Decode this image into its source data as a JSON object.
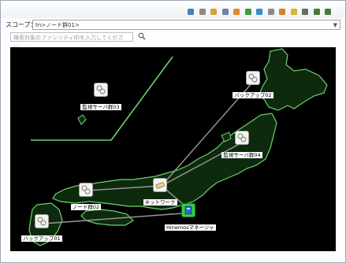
{
  "toolbar": {
    "buttons": [
      {
        "name": "chart-icon",
        "color": "#4a7fb5"
      },
      {
        "name": "layout-icon",
        "color": "#8a8a8a"
      },
      {
        "name": "pin-icon",
        "color": "#d8a23a"
      },
      {
        "name": "list-icon",
        "color": "#6a85a6"
      },
      {
        "name": "node-add-icon",
        "color": "#e08a2a"
      },
      {
        "name": "tree-icon",
        "color": "#3f9a3f"
      },
      {
        "name": "network-icon",
        "color": "#3a8ac7"
      },
      {
        "name": "document-icon",
        "color": "#8a8a8a"
      },
      {
        "name": "settings-icon",
        "color": "#c98a2a"
      },
      {
        "name": "star-icon",
        "color": "#d8b23a"
      },
      {
        "name": "fit-icon",
        "color": "#6a6a6a"
      },
      {
        "name": "zoom-out-icon",
        "color": "#4a7a3a"
      },
      {
        "name": "zoom-in-icon",
        "color": "#4a7a3a"
      }
    ]
  },
  "scope": {
    "label": "スコープ：",
    "value": "tn>ノード群01>"
  },
  "search": {
    "placeholder": "検索対象のファシリティIDを入力してください..."
  },
  "map": {
    "background": "#000000",
    "land_color": "#0d2a0d",
    "coast_color": "#6fd06f",
    "nodes": [
      {
        "id": "web01",
        "label": "監視サーバ群03",
        "type": "server"
      },
      {
        "id": "backup02",
        "label": "バックアップ02",
        "type": "server"
      },
      {
        "id": "web02",
        "label": "監視サーバ群04",
        "type": "server"
      },
      {
        "id": "network",
        "label": "ネットワーク",
        "type": "network"
      },
      {
        "id": "node02",
        "label": "ノード群02",
        "type": "server"
      },
      {
        "id": "manager",
        "label": "Hinemosマネージャ",
        "type": "manager"
      },
      {
        "id": "backup01",
        "label": "バックアップ01",
        "type": "server"
      }
    ]
  }
}
